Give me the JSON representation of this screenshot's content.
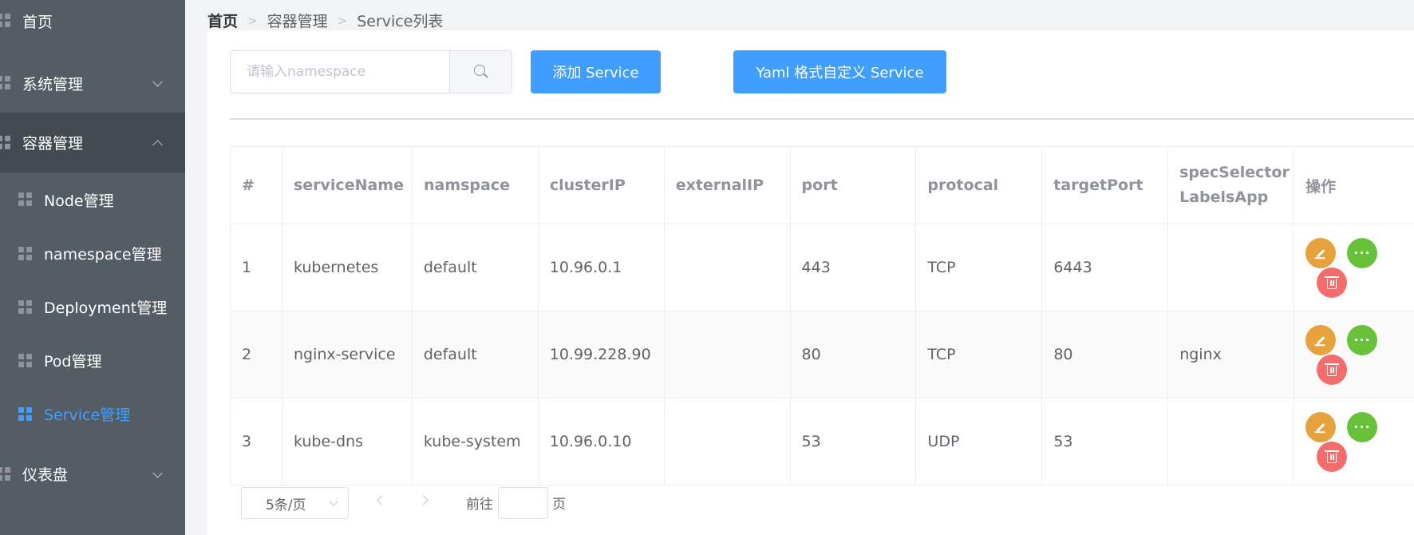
{
  "sidebar": {
    "items": [
      {
        "label": "首页",
        "icon": "grid-icon"
      },
      {
        "label": "系统管理",
        "icon": "grid-icon"
      },
      {
        "label": "容器管理",
        "icon": "grid-icon"
      },
      {
        "label": "Node管理",
        "icon": "grid-icon"
      },
      {
        "label": "namespace管理",
        "icon": "grid-icon"
      },
      {
        "label": "Deployment管理",
        "icon": "grid-icon"
      },
      {
        "label": "Pod管理",
        "icon": "grid-icon"
      },
      {
        "label": "Service管理",
        "icon": "grid-icon",
        "active": true
      },
      {
        "label": "仪表盘",
        "icon": "grid-icon"
      }
    ]
  },
  "breadcrumb": [
    "首页",
    "容器管理",
    "Service列表"
  ],
  "toolbar": {
    "search_placeholder": "请输入namespace",
    "search_value": "",
    "add_label": "添加 Service",
    "yaml_label": "Yaml 格式自定义 Service"
  },
  "table": {
    "headers": [
      "#",
      "serviceName",
      "namspace",
      "clusterIP",
      "externalIP",
      "port",
      "protocal",
      "targetPort",
      "specSelector LabelsApp",
      "操作"
    ],
    "rows": [
      [
        "1",
        "kubernetes",
        "default",
        "10.96.0.1",
        "",
        "443",
        "TCP",
        "6443",
        ""
      ],
      [
        "2",
        "nginx-service",
        "default",
        "10.99.228.90",
        "",
        "80",
        "TCP",
        "80",
        "nginx"
      ],
      [
        "3",
        "kube-dns",
        "kube-system",
        "10.96.0.10",
        "",
        "53",
        "UDP",
        "53",
        ""
      ]
    ]
  },
  "pagination": {
    "page_size": "5条/页",
    "goto_prefix": "前往",
    "goto_suffix": "页",
    "goto_value": ""
  },
  "colors": {
    "sidebar_bg": "#545c64",
    "accent": "#409eff",
    "edit": "#e6a23c",
    "more": "#67c23a",
    "delete": "#f56c6c"
  }
}
